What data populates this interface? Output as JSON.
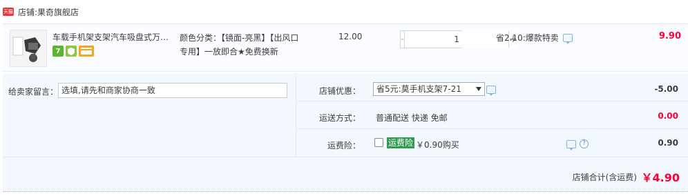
{
  "store": {
    "badge": "天猫",
    "prefix": "店铺:",
    "name": "果奇旗舰店"
  },
  "item": {
    "title": "车载手机架支架汽车吸盘式万能...",
    "attributes": "颜色分类：【镜面-亮黑】【出风口专用】一放即合★免费换新",
    "unit_price": "12.00",
    "quantity": "1",
    "qty_minus": "-",
    "qty_plus": "+",
    "promo": "省2.10:爆款特卖",
    "total": "9.90",
    "service_icons": [
      "seven-day-return-icon",
      "shield-icon",
      "credit-card-icon"
    ]
  },
  "extras": {
    "message_label": "给卖家留言：",
    "message_value": "选填,请先和商家协商一致",
    "store_discount_label": "店铺优惠：",
    "store_discount_selected": "省5元:莫手机支架7-21",
    "store_discount_value": "-5.00",
    "shipping_label": "运送方式：",
    "shipping_value": "普通配送 快递 免邮",
    "shipping_fee": "0.00",
    "insurance_label": "运费险：",
    "insurance_badge": "运费险",
    "insurance_price": "￥0.90购买",
    "insurance_value": "0.90"
  },
  "summary": {
    "label": "店铺合计(含运费)",
    "value": "￥4.90"
  },
  "colors": {
    "accent_red": "#ff0036",
    "panel_bg": "#f3f8fe",
    "insurance_green": "#2e9b4f"
  }
}
